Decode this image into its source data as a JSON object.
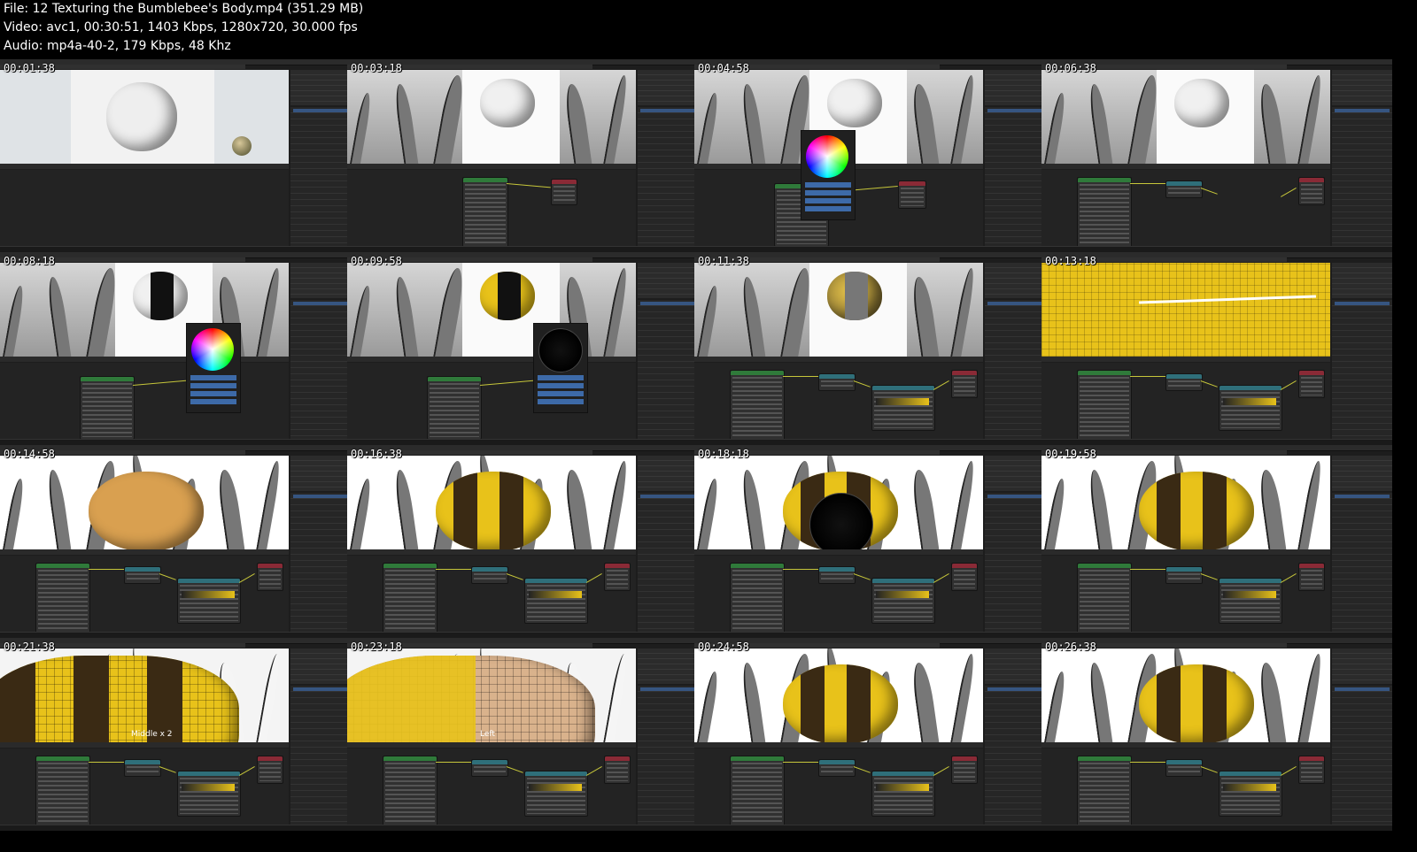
{
  "header": {
    "file_line": "File: 12 Texturing the Bumblebee's Body.mp4 (351.29 MB)",
    "video_line": "Video: avc1, 00:30:51, 1403 Kbps, 1280x720, 30.000 fps",
    "audio_line": "Audio: mp4a-40-2, 179 Kbps, 48 Khz"
  },
  "thumbnails": [
    {
      "timestamp": "00:01:38",
      "scene": "white bee model in viewport, empty node editor"
    },
    {
      "timestamp": "00:03:18",
      "scene": "principled bsdf node"
    },
    {
      "timestamp": "00:04:58",
      "scene": "color wheel picker"
    },
    {
      "timestamp": "00:06:38",
      "scene": "node editor"
    },
    {
      "timestamp": "00:08:18",
      "scene": "color wheel picker"
    },
    {
      "timestamp": "00:09:58",
      "scene": "black picker, yellow bee"
    },
    {
      "timestamp": "00:11:38",
      "scene": "color ramp node"
    },
    {
      "timestamp": "00:13:18",
      "scene": "yellow bee mesh close up"
    },
    {
      "timestamp": "00:14:58",
      "scene": "orange bee body"
    },
    {
      "timestamp": "00:16:38",
      "scene": "striped bee body"
    },
    {
      "timestamp": "00:18:18",
      "scene": "dark color wheel picker"
    },
    {
      "timestamp": "00:19:58",
      "scene": "striped bee in grass"
    },
    {
      "timestamp": "00:21:38",
      "scene": "bee stripes close up",
      "label": "Middle x 2"
    },
    {
      "timestamp": "00:23:18",
      "scene": "bee body side",
      "label": "Left"
    },
    {
      "timestamp": "00:24:58",
      "scene": "bee in grass"
    },
    {
      "timestamp": "00:26:38",
      "scene": "bee front view"
    }
  ],
  "colors": {
    "background": "#000000",
    "blender_dark": "#1d1d1d",
    "accent_blue": "#3d6aa8",
    "bee_yellow": "#e8c21a",
    "bee_brown": "#3a2a14",
    "node_green": "#2f7a3a",
    "node_red": "#8a2a36",
    "node_teal": "#2f6f7a"
  }
}
